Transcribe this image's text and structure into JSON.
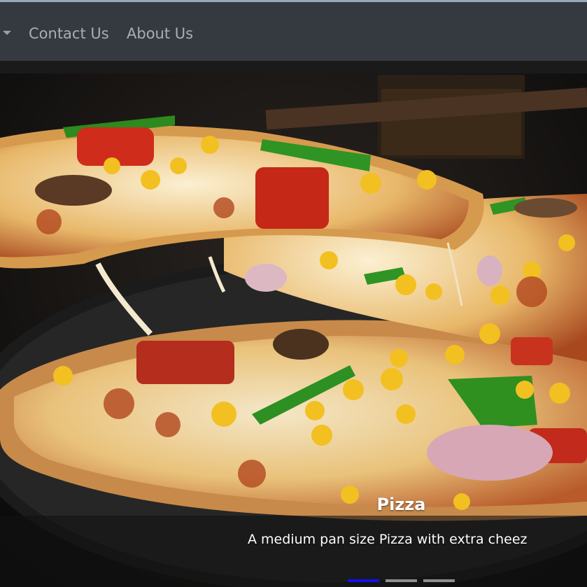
{
  "navbar": {
    "dropdown_icon": "caret-down-icon",
    "links": [
      {
        "label": "Contact Us"
      },
      {
        "label": "About Us"
      }
    ]
  },
  "carousel": {
    "slide": {
      "image": "pizza-photo",
      "caption_title": "Pizza",
      "caption_text": "A medium pan size Pizza with extra cheez"
    },
    "indicator_count": 3,
    "active_indicator": 0
  },
  "colors": {
    "navbar_bg": "#343a40",
    "nav_link": "#a9aeb3",
    "indicator_active": "#1010f0",
    "indicator_inactive": "#8f8f8f"
  }
}
